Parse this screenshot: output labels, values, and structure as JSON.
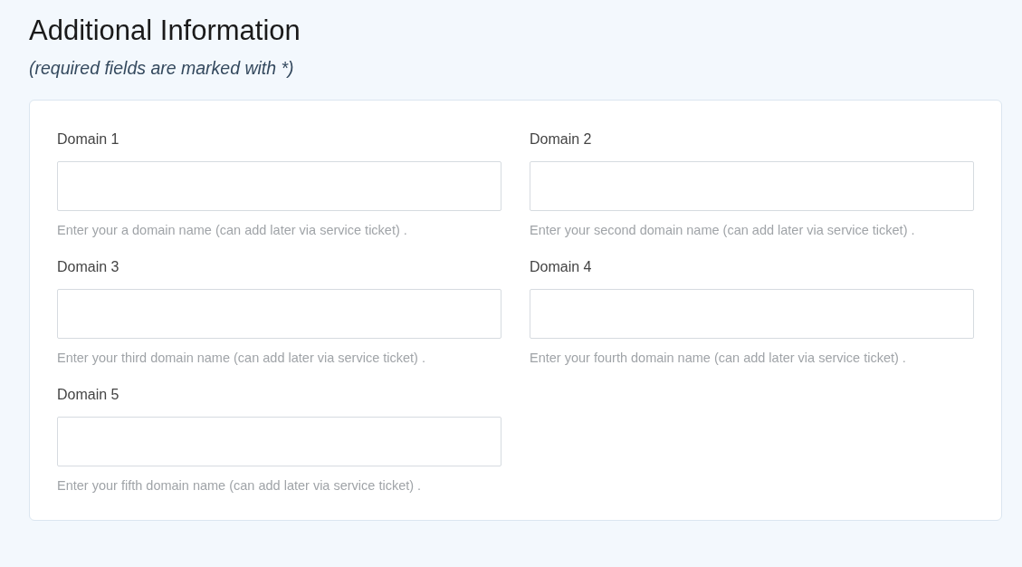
{
  "heading": "Additional Information",
  "note": "(required fields are marked with *)",
  "fields": [
    {
      "label": "Domain 1",
      "help": "Enter your a domain name (can add later via service ticket) ."
    },
    {
      "label": "Domain 2",
      "help": "Enter your second domain name (can add later via service ticket) ."
    },
    {
      "label": "Domain 3",
      "help": "Enter your third domain name (can add later via service ticket) ."
    },
    {
      "label": "Domain 4",
      "help": "Enter your fourth domain name (can add later via service ticket) ."
    },
    {
      "label": "Domain 5",
      "help": "Enter your fifth domain name (can add later via service ticket) ."
    }
  ]
}
